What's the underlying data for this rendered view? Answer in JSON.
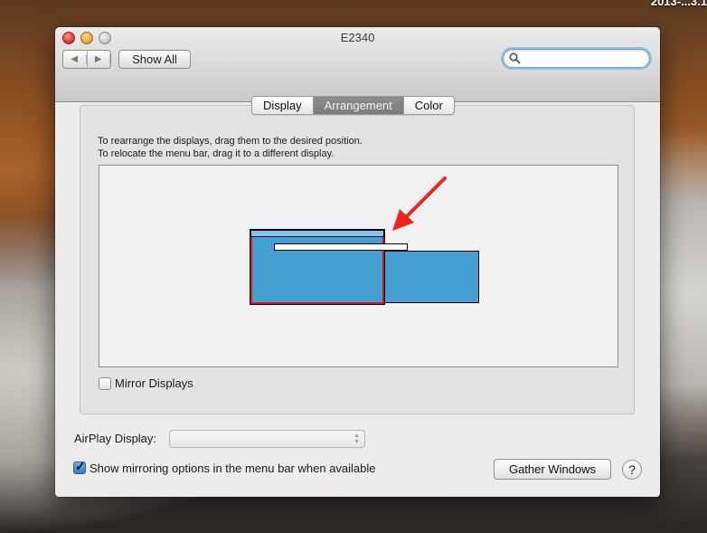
{
  "desktop": {
    "top_right_label": "2013-...3.1"
  },
  "window": {
    "title": "E2340",
    "nav_back_icon": "left-triangle",
    "nav_forward_icon": "right-triangle",
    "show_all_label": "Show All",
    "search": {
      "placeholder": "",
      "value": ""
    }
  },
  "tabs": [
    {
      "label": "Display",
      "active": false
    },
    {
      "label": "Arrangement",
      "active": true
    },
    {
      "label": "Color",
      "active": false
    }
  ],
  "arrangement": {
    "instruction_line1": "To rearrange the displays, drag them to the desired position.",
    "instruction_line2": "To relocate the menu bar, drag it to a different display.",
    "displays": [
      {
        "name": "main-display",
        "has_menu_bar": true,
        "selected": true
      },
      {
        "name": "secondary-display",
        "has_menu_bar": false,
        "selected": false
      }
    ],
    "annotation": "red-arrow pointing at menu bar being dragged"
  },
  "mirror_displays": {
    "label": "Mirror Displays",
    "checked": false
  },
  "airplay": {
    "label": "AirPlay Display:",
    "selected_value": ""
  },
  "show_mirroring": {
    "label": "Show mirroring options in the menu bar when available",
    "checked": true
  },
  "gather_windows_label": "Gather Windows",
  "help_label": "?",
  "colors": {
    "display_fill": "#459fd3",
    "menu_bar_fill": "#7cc4f2",
    "selection_border": "#e0101b",
    "arrow": "#f0241f"
  }
}
